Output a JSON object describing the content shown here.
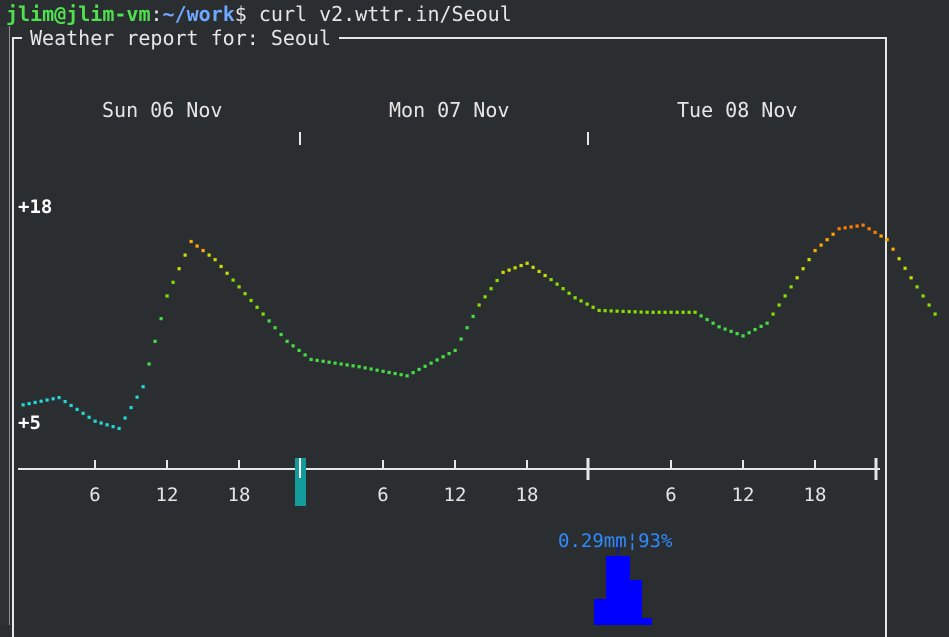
{
  "terminal": {
    "prompt_user": "jlim@jlim-vm",
    "prompt_sep": ":",
    "prompt_path": "~/work",
    "prompt_symbol": "$",
    "command": " curl v2.wttr.in/Seoul"
  },
  "report": {
    "title": "Weather report for: Seoul",
    "days": [
      "Sun 06 Nov",
      "Mon 07 Nov",
      "Tue 08 Nov"
    ],
    "y_labels": [
      "+18",
      "+5"
    ],
    "hour_ticks": [
      "6",
      "12",
      "18",
      "6",
      "12",
      "18",
      "6",
      "12",
      "18"
    ],
    "rain_label": "0.29mm¦93%"
  },
  "chart_data": {
    "type": "line",
    "title": "",
    "xlabel": "",
    "ylabel": "",
    "ylim": [
      5,
      18
    ],
    "x_unit": "hours from Sun 06 Nov 00:00",
    "series": [
      {
        "values": [
          [
            0,
            6.5
          ],
          [
            3,
            6.9
          ],
          [
            6,
            5.6
          ],
          [
            8,
            5.2
          ],
          [
            10,
            7.5
          ],
          [
            12,
            12.5
          ],
          [
            14,
            15.5
          ],
          [
            16,
            14.5
          ],
          [
            18,
            13.0
          ],
          [
            20,
            11.5
          ],
          [
            22,
            10.0
          ],
          [
            24,
            9.0
          ],
          [
            28,
            8.6
          ],
          [
            32,
            8.1
          ],
          [
            36,
            9.5
          ],
          [
            38,
            12.0
          ],
          [
            40,
            13.8
          ],
          [
            42,
            14.3
          ],
          [
            44,
            13.4
          ],
          [
            46,
            12.4
          ],
          [
            48,
            11.7
          ],
          [
            52,
            11.6
          ],
          [
            56,
            11.6
          ],
          [
            58,
            10.8
          ],
          [
            60,
            10.3
          ],
          [
            62,
            11.0
          ],
          [
            64,
            13.0
          ],
          [
            66,
            15.0
          ],
          [
            68,
            16.2
          ],
          [
            70,
            16.4
          ],
          [
            72,
            15.6
          ],
          [
            74,
            13.5
          ],
          [
            76,
            11.5
          ]
        ]
      }
    ],
    "temperature_colors": [
      "#22d8d8",
      "#44dd44",
      "#88e000",
      "#ccdd00",
      "#ffaa00",
      "#ff7a00"
    ]
  },
  "rain": {
    "bar_color": "#0000ff",
    "marker_color": "#139a9a"
  }
}
